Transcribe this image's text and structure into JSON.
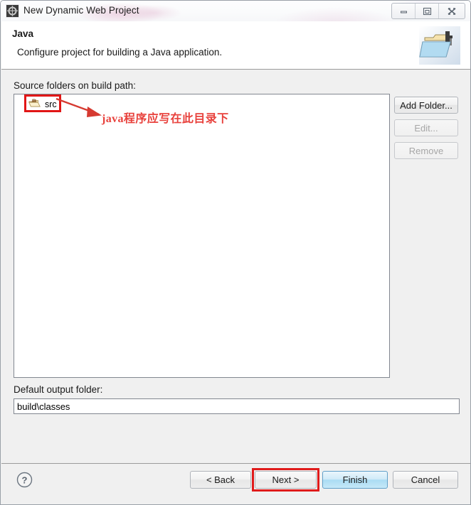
{
  "window": {
    "title": "New Dynamic Web Project",
    "app_icon": "eclipse-icon",
    "controls": {
      "minimize": "minimize-icon",
      "maximize": "maximize-icon",
      "close": "close-icon"
    }
  },
  "header": {
    "title": "Java",
    "description": "Configure project for building a Java application.",
    "banner_icon": "java-project-folder-icon"
  },
  "main": {
    "source_folders_label": "Source folders on build path:",
    "tree": {
      "items": [
        {
          "label": "src",
          "icon": "source-folder-icon"
        }
      ]
    },
    "side_buttons": [
      {
        "label": "Add Folder...",
        "enabled": true
      },
      {
        "label": "Edit...",
        "enabled": false
      },
      {
        "label": "Remove",
        "enabled": false
      }
    ],
    "output": {
      "label": "Default output folder:",
      "value": "build\\classes",
      "placeholder": ""
    }
  },
  "annotation": {
    "text": "java程序应写在此目录下",
    "color": "#e8413c",
    "highlight_color": "#e11616",
    "targets": [
      "src-tree-item",
      "next-button"
    ]
  },
  "footer": {
    "help_label": "?",
    "buttons": [
      {
        "label": "< Back",
        "name": "back"
      },
      {
        "label": "Next >",
        "name": "next"
      },
      {
        "label": "Finish",
        "name": "finish"
      },
      {
        "label": "Cancel",
        "name": "cancel"
      }
    ]
  }
}
